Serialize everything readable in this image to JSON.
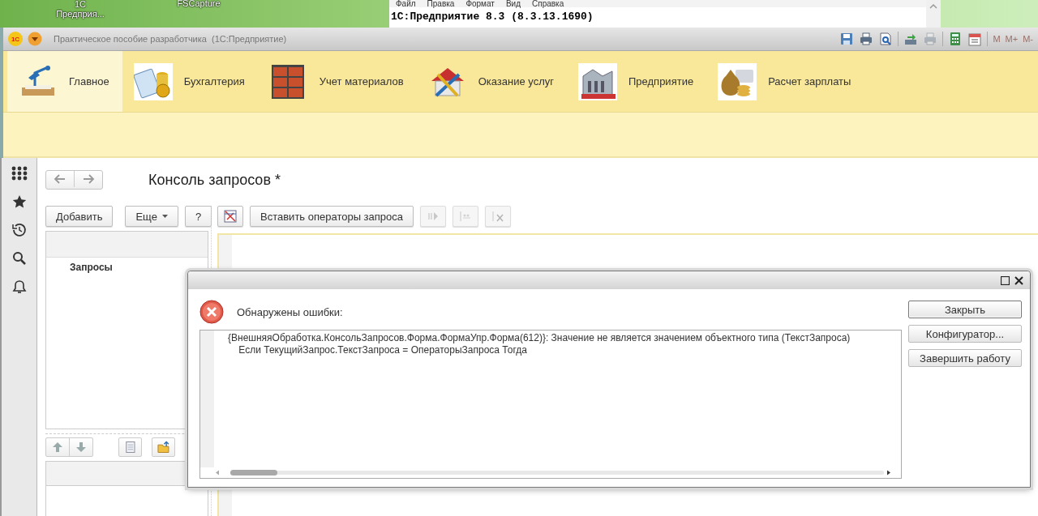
{
  "desktop": {
    "icons": [
      {
        "label": "1С Предприя..."
      },
      {
        "label": "FSCapture"
      }
    ],
    "background_window": {
      "menu": [
        "Файл",
        "Правка",
        "Формат",
        "Вид",
        "Справка"
      ],
      "text": "1С:Предприятие 8.3 (8.3.13.1690)"
    }
  },
  "window": {
    "logo": "1С",
    "title": "Практическое пособие разработчика  (1С:Предприятие)",
    "tools": [
      {
        "kind": "save",
        "disabled": false
      },
      {
        "kind": "print",
        "disabled": false
      },
      {
        "kind": "preview",
        "disabled": false
      },
      {
        "kind": "import",
        "disabled": false
      },
      {
        "kind": "print",
        "disabled": true
      },
      {
        "kind": "calculator",
        "disabled": false
      },
      {
        "kind": "calendar",
        "disabled": false
      },
      {
        "kind": "text",
        "label": "M",
        "disabled": true
      },
      {
        "kind": "text",
        "label": "M+",
        "disabled": true
      },
      {
        "kind": "text",
        "label": "M-",
        "disabled": true
      }
    ]
  },
  "sections": [
    {
      "label": "Главное",
      "selected": true
    },
    {
      "label": "Бухгалтерия",
      "selected": false
    },
    {
      "label": "Учет материалов",
      "selected": false
    },
    {
      "label": "Оказание услуг",
      "selected": false
    },
    {
      "label": "Предприятие",
      "selected": false
    },
    {
      "label": "Расчет зарплаты",
      "selected": false
    }
  ],
  "form": {
    "title": "Консоль запросов *",
    "list_toolbar": [
      {
        "kind": "button",
        "label": "Добавить",
        "disabled": false
      },
      {
        "kind": "dropdown",
        "label": "Еще",
        "disabled": false
      },
      {
        "kind": "button",
        "label": "?",
        "disabled": false
      }
    ],
    "editor_toolbar": [
      {
        "kind": "icon",
        "disabled": false
      },
      {
        "kind": "button",
        "label": "Вставить операторы запроса",
        "disabled": false
      },
      {
        "kind": "icon",
        "disabled": true
      },
      {
        "kind": "icon",
        "disabled": true
      },
      {
        "kind": "icon",
        "disabled": true
      }
    ],
    "queries": [
      "Запросы"
    ]
  },
  "dialog": {
    "heading": "Обнаружены ошибки:",
    "message_lines": [
      "{ВнешняяОбработка.КонсольЗапросов.Форма.ФормаУпр.Форма(612)}: Значение не является значением объектного типа (ТекстЗапроса)",
      "    Если ТекущийЗапрос.ТекстЗапроса = ОператорыЗапроса Тогда"
    ],
    "buttons": [
      {
        "label": "Закрыть",
        "selected": true
      },
      {
        "label": "Конфигуратор...",
        "selected": false
      },
      {
        "label": "Завершить работу",
        "selected": false
      }
    ]
  }
}
